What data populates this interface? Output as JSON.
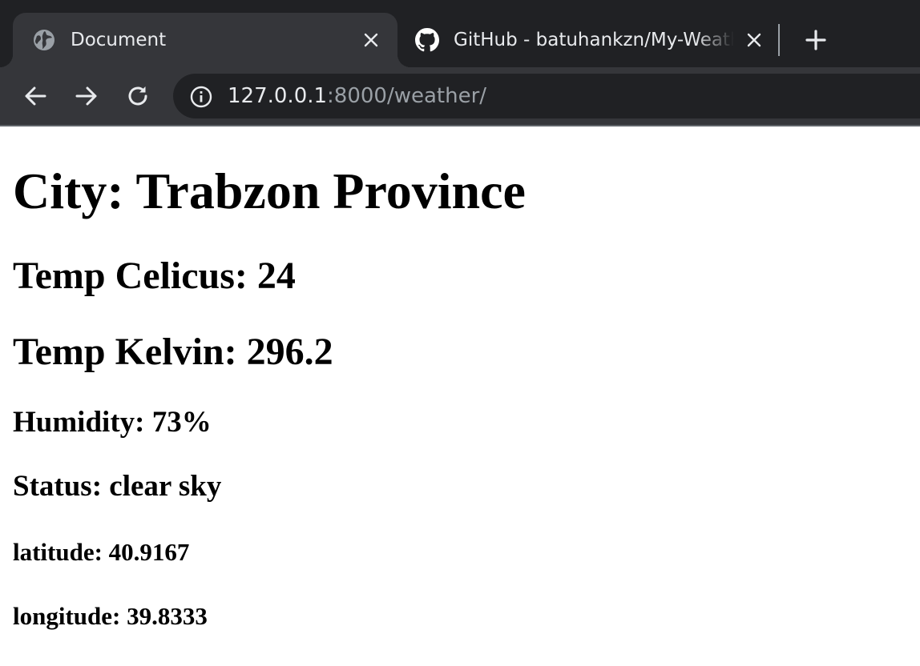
{
  "browser": {
    "tabs": [
      {
        "title": "Document",
        "icon": "globe-icon",
        "active": true
      },
      {
        "title": "GitHub - batuhankzn/My-Weather",
        "icon": "github-icon",
        "active": false
      }
    ],
    "address": {
      "host": "127.0.0.1",
      "rest": ":8000/weather/"
    }
  },
  "weather": {
    "city": "City: Trabzon Province",
    "temp_celsius": "Temp Celicus: 24",
    "temp_kelvin": "Temp Kelvin: 296.2",
    "humidity": "Humidity: 73%",
    "status": "Status: clear sky",
    "latitude": "latitude: 40.9167",
    "longitude": "longitude: 39.8333"
  },
  "colors": {
    "tabstrip_bg": "#202124",
    "toolbar_bg": "#35363a",
    "omnibox_bg": "#202124",
    "chrome_text": "#e8eaed",
    "url_dim": "#9aa0a6",
    "page_bg": "#ffffff",
    "page_text": "#000000"
  }
}
